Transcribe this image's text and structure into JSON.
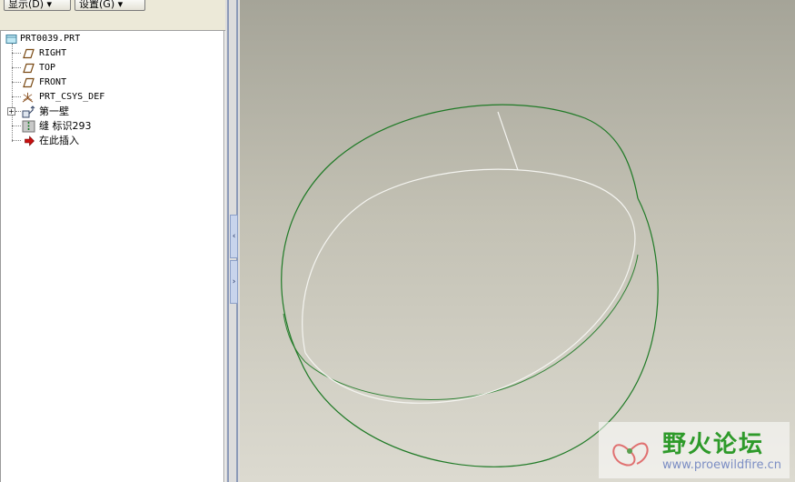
{
  "toolbar": {
    "show_label": "显示(D) ▾",
    "settings_label": "设置(G) ▾"
  },
  "model_tree": {
    "root": "PRT0039.PRT",
    "items": [
      {
        "label": "RIGHT",
        "icon": "datum-plane-icon"
      },
      {
        "label": "TOP",
        "icon": "datum-plane-icon"
      },
      {
        "label": "FRONT",
        "icon": "datum-plane-icon"
      },
      {
        "label": "PRT_CSYS_DEF",
        "icon": "coordinate-system-icon"
      },
      {
        "label": "第一壁",
        "icon": "sheetmetal-wall-icon"
      },
      {
        "label": "缝 标识293",
        "icon": "rip-feature-icon"
      },
      {
        "label": "在此插入",
        "icon": "insert-here-arrow-icon"
      }
    ]
  },
  "splitter": {
    "collapse_glyph": "‹",
    "expand_glyph": "›"
  },
  "watermark": {
    "title": "野火论坛",
    "url": "www.proewildfire.cn"
  },
  "colors": {
    "edge_green": "#1f7a26",
    "edge_white": "#f4f4f0",
    "wm_green": "#2e9a2a"
  }
}
